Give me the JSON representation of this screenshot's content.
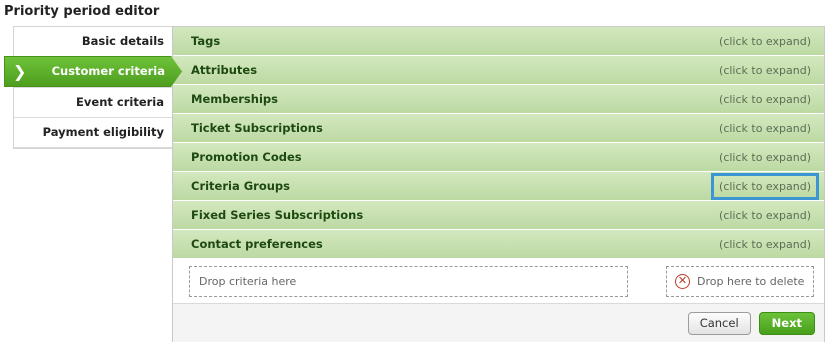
{
  "page": {
    "title": "Priority period editor"
  },
  "nav": {
    "items": [
      {
        "label": "Basic details"
      },
      {
        "label": "Customer criteria",
        "active": true
      },
      {
        "label": "Event criteria"
      },
      {
        "label": "Payment eligibility"
      }
    ],
    "active_icon": "chevron-right-icon"
  },
  "sections": [
    {
      "title": "Tags",
      "hint": "(click to expand)"
    },
    {
      "title": "Attributes",
      "hint": "(click to expand)"
    },
    {
      "title": "Memberships",
      "hint": "(click to expand)"
    },
    {
      "title": "Ticket Subscriptions",
      "hint": "(click to expand)"
    },
    {
      "title": "Promotion Codes",
      "hint": "(click to expand)"
    },
    {
      "title": "Criteria Groups",
      "hint": "(click to expand)",
      "highlighted": true
    },
    {
      "title": "Fixed Series Subscriptions",
      "hint": "(click to expand)"
    },
    {
      "title": "Contact preferences",
      "hint": "(click to expand)"
    }
  ],
  "drop": {
    "criteria_label": "Drop criteria here",
    "delete_label": "Drop here to delete",
    "delete_icon": "circle-x-icon"
  },
  "footer": {
    "cancel_label": "Cancel",
    "next_label": "Next"
  },
  "colors": {
    "accent_green": "#5cb12e",
    "section_green": "#c8e0b1",
    "highlight_blue": "#3b96d2",
    "delete_red": "#c0392b"
  }
}
